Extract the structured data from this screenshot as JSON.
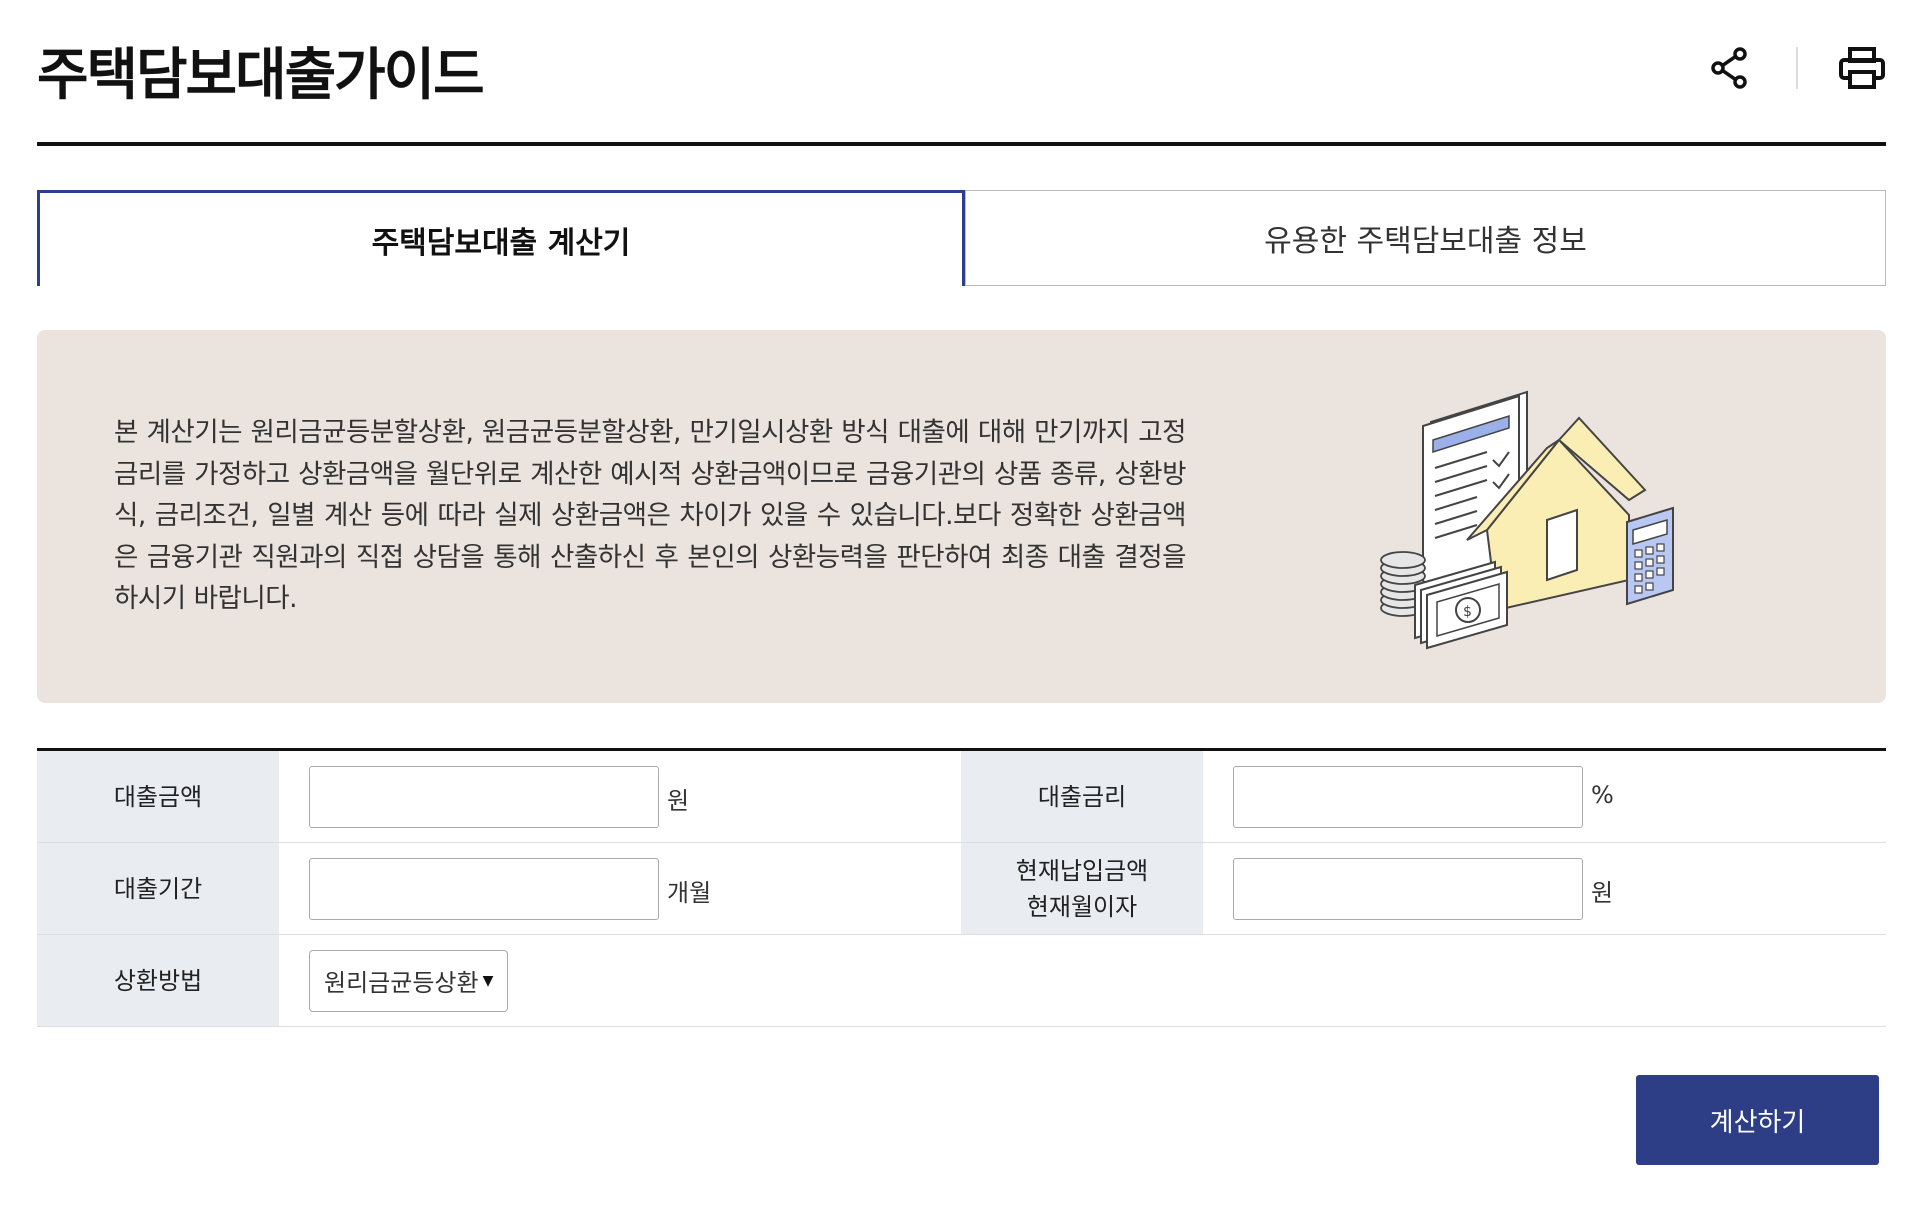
{
  "header": {
    "title": "주택담보대출가이드",
    "share_icon": "share-icon",
    "print_icon": "printer-icon"
  },
  "tabs": [
    {
      "label": "주택담보대출 계산기",
      "active": true
    },
    {
      "label": "유용한 주택담보대출 정보",
      "active": false
    }
  ],
  "info": {
    "text": "본 계산기는 원리금균등분할상환, 원금균등분할상환, 만기일시상환 방식 대출에 대해 만기까지 고정금리를 가정하고 상환금액을 월단위로 계산한 예시적 상환금액이므로 금융기관의 상품 종류, 상환방식, 금리조건, 일별 계산 등에 따라 실제 상환금액은 차이가 있을 수 있습니다.보다 정확한 상환금액은 금융기관 직원과의 직접 상담을 통해 산출하신 후 본인의 상환능력을 판단하여 최종 대출 결정을 하시기 바랍니다.",
    "illustration": "loan-calculation-illustration"
  },
  "form": {
    "loan_amount": {
      "label": "대출금액",
      "value": "",
      "unit": "원"
    },
    "interest_rate": {
      "label": "대출금리",
      "value": "",
      "unit": "%"
    },
    "loan_period": {
      "label": "대출기간",
      "value": "",
      "unit": "개월"
    },
    "current_payment": {
      "label_line1": "현재납입금액",
      "label_line2": "현재월이자",
      "value": "",
      "unit": "원"
    },
    "repayment_method": {
      "label": "상환방법",
      "selected": "원리금균등상환"
    }
  },
  "actions": {
    "calculate_label": "계산하기"
  },
  "colors": {
    "accent": "#2d3e87",
    "info_bg": "#ebe4de",
    "label_bg": "#e9ecf1"
  }
}
